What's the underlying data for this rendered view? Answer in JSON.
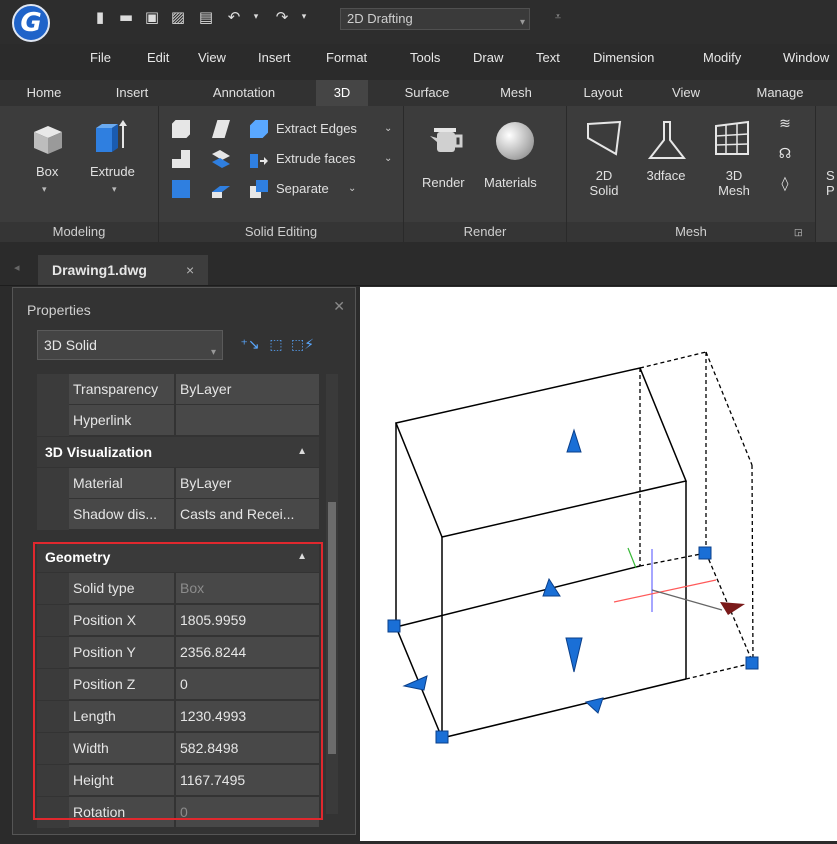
{
  "app": {
    "logo_letter": "G",
    "quick_access": {
      "icons": [
        "new-file-icon",
        "open-folder-icon",
        "save-icon",
        "save-as-icon",
        "print-icon",
        "undo-icon",
        "redo-icon"
      ],
      "workspace_value": "2D Drafting"
    }
  },
  "menubar": {
    "items": [
      "File",
      "Edit",
      "View",
      "Insert",
      "Format",
      "Tools",
      "Draw",
      "Text",
      "Dimension",
      "Modify",
      "Window"
    ]
  },
  "ribbon": {
    "tabs": [
      "Home",
      "Insert",
      "Annotation",
      "3D",
      "Surface",
      "Mesh",
      "Layout",
      "View",
      "Manage"
    ],
    "active_tab": "3D",
    "modeling": {
      "title": "Modeling",
      "box_label": "Box",
      "extrude_label": "Extrude"
    },
    "solid_editing": {
      "title": "Solid Editing",
      "extract_edges": "Extract Edges",
      "extrude_faces": "Extrude faces",
      "separate": "Separate"
    },
    "render": {
      "title": "Render",
      "render_label": "Render",
      "materials_label": "Materials"
    },
    "mesh": {
      "title": "Mesh",
      "solid2d_line1": "2D",
      "solid2d_line2": "Solid",
      "face3d": "3dface",
      "mesh3d_line1": "3D",
      "mesh3d_line2": "Mesh"
    },
    "partial_next": {
      "line1": "S",
      "line2": "P"
    }
  },
  "document": {
    "tab_label": "Drawing1.dwg",
    "close_glyph": "×"
  },
  "properties": {
    "title": "Properties",
    "object_type": "3D Solid",
    "general_rows": [
      {
        "name": "Transparency",
        "value": "ByLayer"
      },
      {
        "name": "Hyperlink",
        "value": ""
      }
    ],
    "visualization": {
      "title": "3D Visualization",
      "rows": [
        {
          "name": "Material",
          "value": "ByLayer"
        },
        {
          "name": "Shadow dis...",
          "value": "Casts and Recei..."
        }
      ]
    },
    "geometry": {
      "title": "Geometry",
      "rows": [
        {
          "name": "Solid type",
          "value": "Box"
        },
        {
          "name": "Position X",
          "value": "1805.9959"
        },
        {
          "name": "Position Y",
          "value": "2356.8244"
        },
        {
          "name": "Position Z",
          "value": "0"
        },
        {
          "name": "Length",
          "value": "1230.4993"
        },
        {
          "name": "Width",
          "value": "582.8498"
        },
        {
          "name": "Height",
          "value": "1167.7495"
        },
        {
          "name": "Rotation",
          "value": "0"
        }
      ]
    }
  },
  "colors": {
    "accent_blue": "#1f63c9",
    "grip_blue": "#1a6fd6",
    "highlight_red": "#e0282e"
  }
}
